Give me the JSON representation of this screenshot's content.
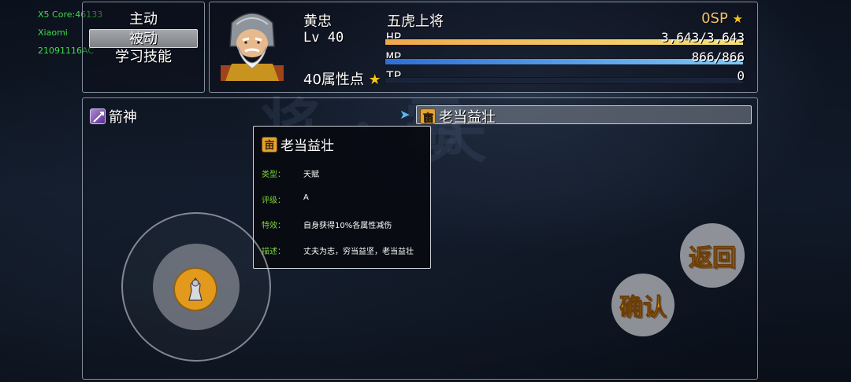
{
  "debug": {
    "core": "X5 Core:46133",
    "brand": "Xiaomi",
    "model": "21091116AC"
  },
  "menu": {
    "items": [
      {
        "label": "主动"
      },
      {
        "label": "被动"
      },
      {
        "label": "学习技能"
      }
    ],
    "selected_index": 1
  },
  "character": {
    "name": "黄忠",
    "level": "Lv 40",
    "class": "五虎上将",
    "sp": "0SP",
    "attribute_points": "40属性点",
    "hp_label": "HP",
    "hp_value": "3,643/3,643",
    "hp_fraction": 1.0,
    "mp_label": "MP",
    "mp_value": "866/866",
    "mp_fraction": 1.0,
    "tp_label": "TP",
    "tp_value": "0",
    "tp_fraction": 0.0
  },
  "skills": {
    "left_item": "箭神",
    "right_item": "老当益壮",
    "cursor": "➤"
  },
  "tooltip": {
    "title": "老当益壮",
    "rows": [
      {
        "key": "类型：",
        "value": "天赋"
      },
      {
        "key": "评级：",
        "value": "A"
      },
      {
        "key": "特效：",
        "value": "自身获得10%各属性减伤"
      },
      {
        "key": "描述：",
        "value": "丈夫为志，穷当益坚，老当益壮"
      }
    ]
  },
  "buttons": {
    "back": "返回",
    "confirm": "确认"
  },
  "colors": {
    "hp_start": "#f0a84a",
    "hp_end": "#f6e27a",
    "mp_start": "#2e6fd6",
    "mp_end": "#7ec8f4",
    "tip_key": "#7dd13a",
    "sp_star": "#f5c518",
    "button_text": "#e8a21e"
  }
}
